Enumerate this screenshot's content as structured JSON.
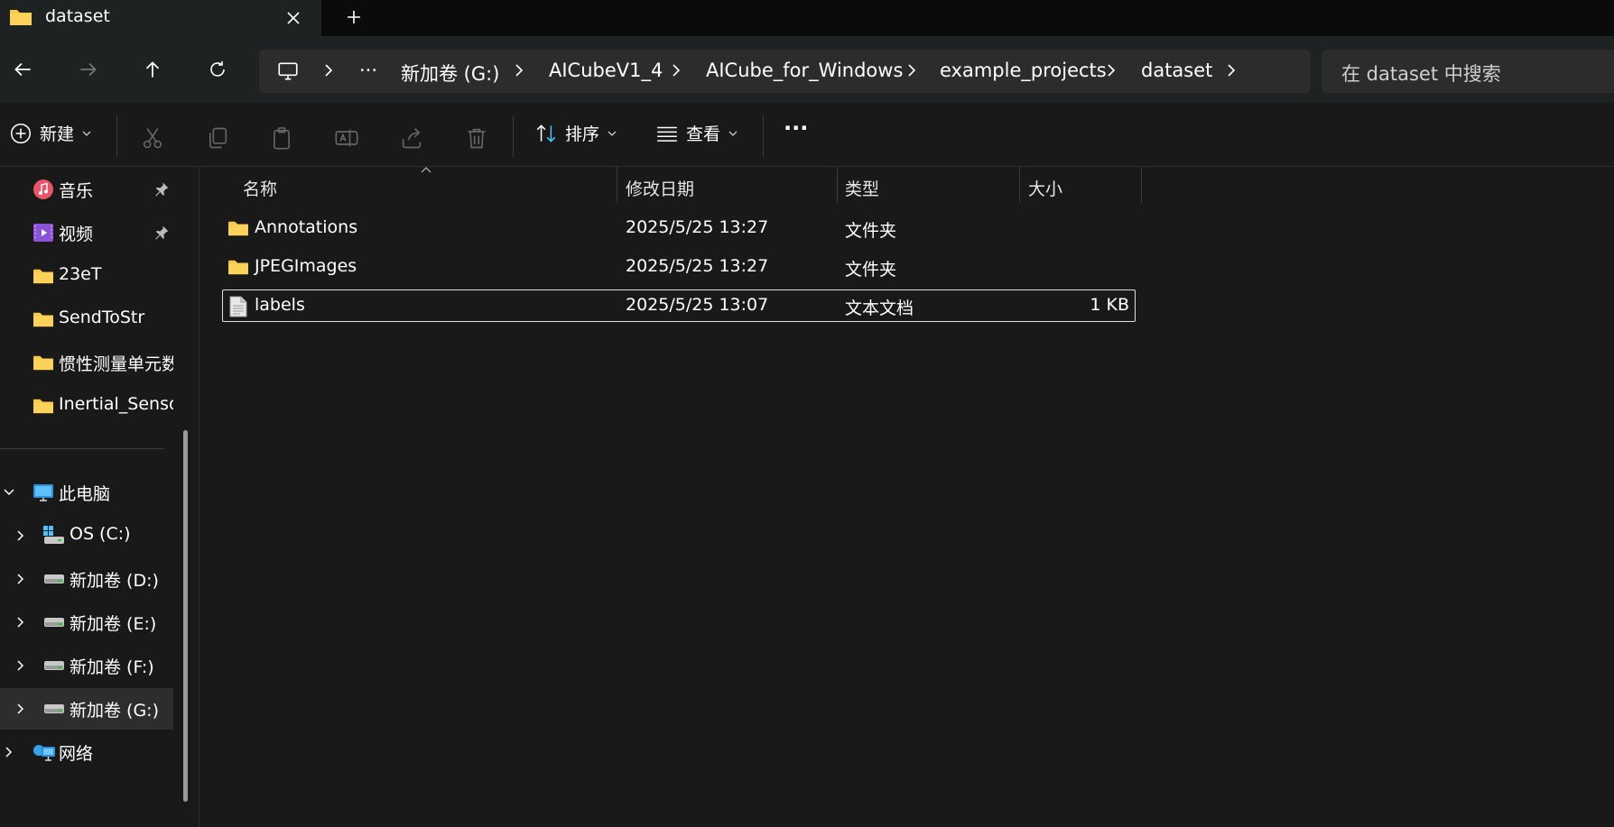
{
  "tab": {
    "title": "dataset",
    "icon": "folder-icon"
  },
  "nav": {
    "back": "arrow-left-icon",
    "forward": "arrow-right-icon",
    "up": "arrow-up-icon",
    "refresh": "refresh-icon"
  },
  "breadcrumb": {
    "overflow": "···",
    "items": [
      "新加卷 (G:)",
      "AICubeV1_4",
      "AICube_for_Windows",
      "example_projects",
      "dataset"
    ]
  },
  "search": {
    "placeholder": "在 dataset 中搜索"
  },
  "toolbar": {
    "new_label": "新建",
    "sort_label": "排序",
    "view_label": "查看",
    "more_label": "···"
  },
  "sidebar": {
    "quick": [
      {
        "label": "音乐",
        "pinned": true,
        "icon": "music-icon"
      },
      {
        "label": "视频",
        "pinned": true,
        "icon": "video-icon"
      },
      {
        "label": "23eT",
        "icon": "folder-icon"
      },
      {
        "label": "SendToStr",
        "icon": "folder-icon"
      },
      {
        "label": "惯性测量单元数据",
        "icon": "folder-icon"
      },
      {
        "label": "Inertial_Sensor",
        "icon": "folder-icon"
      }
    ],
    "this_pc": {
      "label": "此电脑",
      "icon": "monitor-icon"
    },
    "drives": [
      {
        "label": "OS (C:)",
        "icon": "os-drive-icon"
      },
      {
        "label": "新加卷 (D:)",
        "icon": "drive-icon"
      },
      {
        "label": "新加卷 (E:)",
        "icon": "drive-icon"
      },
      {
        "label": "新加卷 (F:)",
        "icon": "drive-icon"
      },
      {
        "label": "新加卷 (G:)",
        "icon": "drive-icon",
        "selected": true
      }
    ],
    "network": {
      "label": "网络",
      "icon": "network-icon"
    }
  },
  "columns": {
    "name": "名称",
    "modified": "修改日期",
    "type": "类型",
    "size": "大小"
  },
  "files": [
    {
      "name": "Annotations",
      "modified": "2025/5/25 13:27",
      "type": "文件夹",
      "size": "",
      "icon": "folder-icon"
    },
    {
      "name": "JPEGImages",
      "modified": "2025/5/25 13:27",
      "type": "文件夹",
      "size": "",
      "icon": "folder-icon"
    },
    {
      "name": "labels",
      "modified": "2025/5/25 13:07",
      "type": "文本文档",
      "size": "1 KB",
      "icon": "text-file-icon",
      "selected": true
    }
  ],
  "colors": {
    "accent": "#4cc2ff",
    "folder": "#f7c948",
    "background": "#191919",
    "chrome": "#1f2223"
  }
}
